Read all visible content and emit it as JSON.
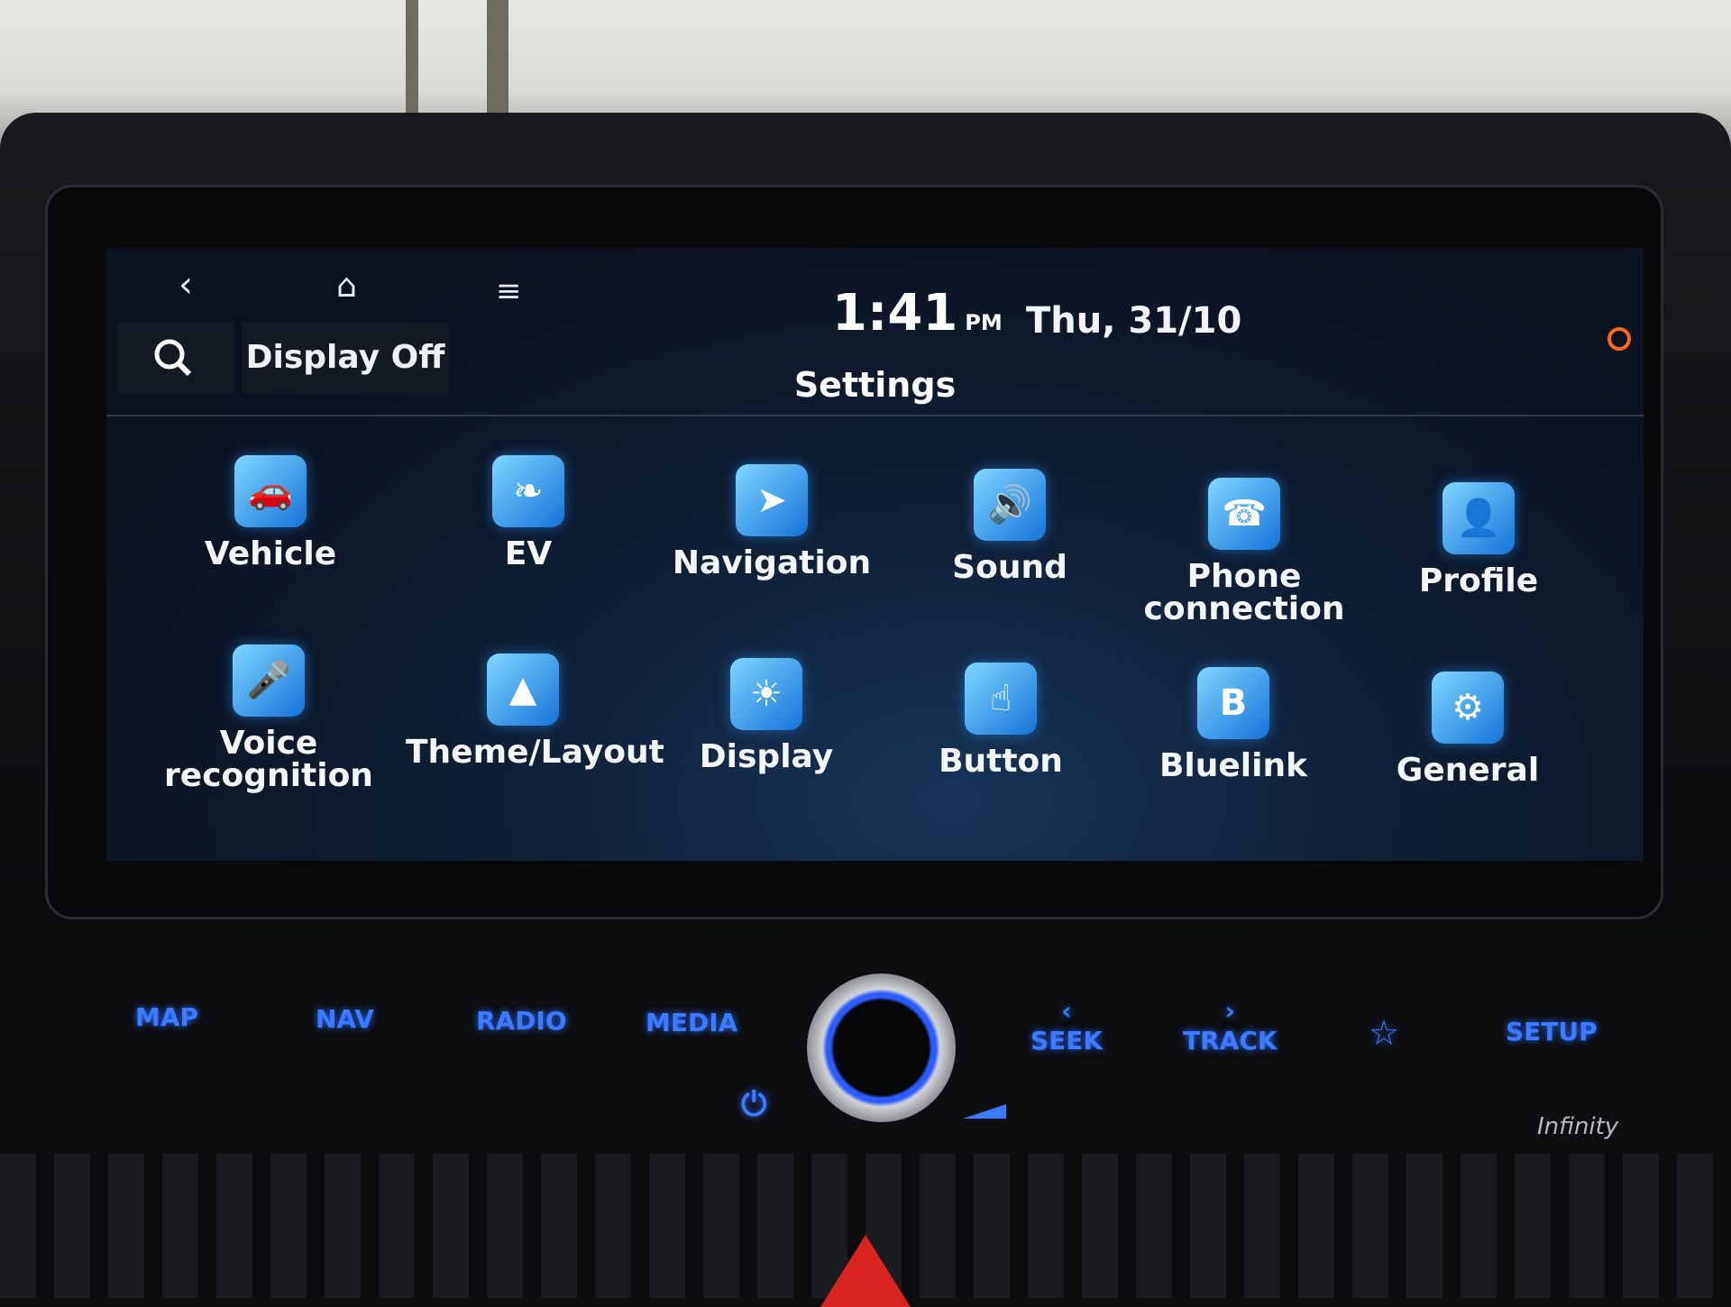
{
  "status_bar": {
    "time": "1:41",
    "ampm": "PM",
    "date": "Thu, 31/10"
  },
  "top_nav": {
    "back_icon": "back-chevron-icon",
    "home_icon": "home-icon",
    "menu_icon": "menu-icon",
    "search_icon": "search-icon",
    "display_off_label": "Display Off",
    "status_icon": "camera-off-icon"
  },
  "page": {
    "title": "Settings"
  },
  "settings_items": [
    {
      "label": "Vehicle",
      "icon": "car-gear-icon"
    },
    {
      "label": "EV",
      "icon": "leaf-gear-icon"
    },
    {
      "label": "Navigation",
      "icon": "navigation-arrow-icon"
    },
    {
      "label": "Sound",
      "icon": "speaker-icon"
    },
    {
      "label": "Phone connection",
      "icon": "phone-icon"
    },
    {
      "label": "Profile",
      "icon": "profile-card-icon"
    },
    {
      "label": "Voice recognition",
      "icon": "microphone-icon"
    },
    {
      "label": "Theme/Layout",
      "icon": "picture-icon"
    },
    {
      "label": "Display",
      "icon": "display-brightness-icon"
    },
    {
      "label": "Button",
      "icon": "button-press-icon"
    },
    {
      "label": "Bluelink",
      "icon": "bluelink-icon"
    },
    {
      "label": "General",
      "icon": "gear-icon"
    }
  ],
  "hardware_buttons": {
    "map": "MAP",
    "nav": "NAV",
    "radio": "RADIO",
    "media": "MEDIA",
    "seek": "SEEK",
    "track": "TRACK",
    "setup": "SETUP",
    "favorite_icon": "star-icon",
    "power_icon": "power-icon",
    "volume_icon": "volume-wedge-icon"
  },
  "brand": {
    "logo": "Infinity"
  },
  "colors": {
    "accent": "#3c7bff",
    "screen_bg": "#0f1e33",
    "status_icon": "#ff6a1a"
  }
}
